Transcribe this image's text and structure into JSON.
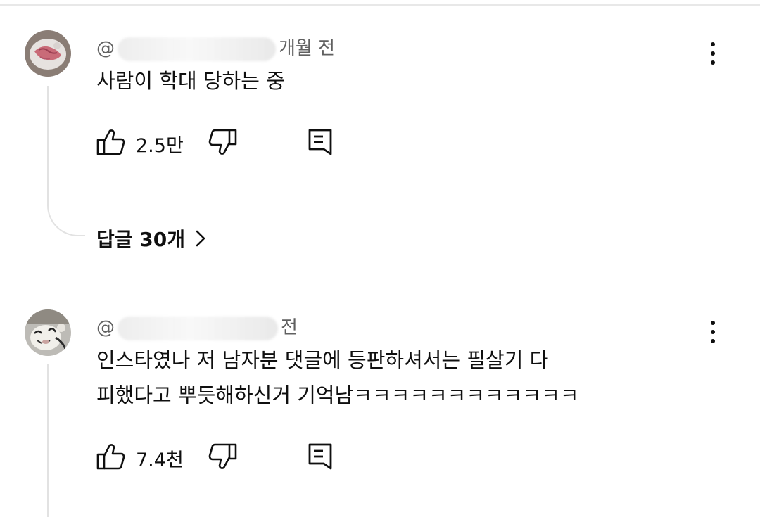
{
  "comments": [
    {
      "author_prefix": "@",
      "time_text": "개월 전",
      "text_lines": [
        "사람이 학대 당하는 중"
      ],
      "likes": "2.5만",
      "replies_label": "답글 30개"
    },
    {
      "author_prefix": "@",
      "time_text": "전",
      "text_lines": [
        "인스타였나 저 남자분 댓글에 등판하셔서는 필살기 다",
        "피했다고 뿌듯해하신거 기억남ㅋㅋㅋㅋㅋㅋㅋㅋㅋㅋㅋㅋ"
      ],
      "likes": "7.4천"
    }
  ],
  "icons": {
    "like": "thumbs-up-icon",
    "dislike": "thumbs-down-icon",
    "reply": "reply-icon",
    "more": "more-vertical-icon",
    "chevron": "chevron-right-icon"
  }
}
